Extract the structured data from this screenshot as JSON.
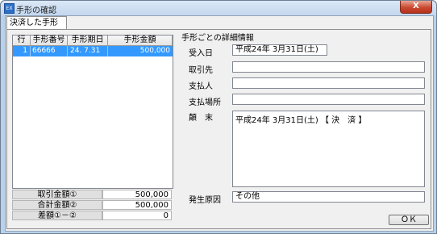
{
  "window": {
    "title": "手形の確認",
    "app_icon": "EX",
    "close_label": "X"
  },
  "tab": {
    "label": "決済した手形"
  },
  "grid": {
    "columns": [
      "行",
      "手形番号",
      "手形期日",
      "手形金額"
    ],
    "rows": [
      {
        "row": "1",
        "number": "66666",
        "date": "24. 7.31",
        "amount": "500,000"
      }
    ]
  },
  "totals": [
    {
      "label": "取引金額①",
      "value": "500,000"
    },
    {
      "label": "合計金額②",
      "value": "500,000"
    },
    {
      "label": "差額①－②",
      "value": "0"
    }
  ],
  "details": {
    "section_title": "手形ごとの詳細情報",
    "received_label": "受入日",
    "received_value": "平成24年 3月31日(土)",
    "client_label": "取引先",
    "client_value": "",
    "payer_label": "支払人",
    "payer_value": "",
    "place_label": "支払場所",
    "place_value": "",
    "summary_label": "顛　末",
    "summary_value": "平成24年 3月31日(土) 【 決　済 】",
    "cause_label": "発生原因",
    "cause_value": "その他"
  },
  "buttons": {
    "ok": "ＯＫ"
  }
}
